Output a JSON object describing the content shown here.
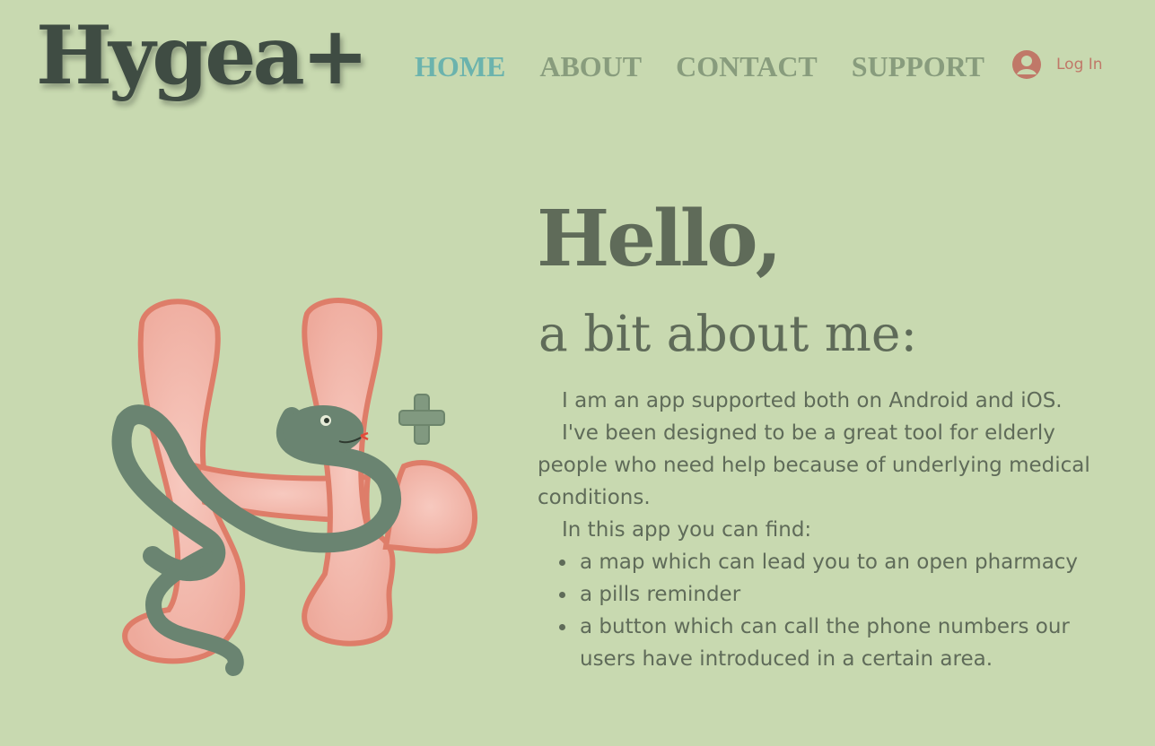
{
  "logo": {
    "text": "Hygea+"
  },
  "nav": {
    "items": [
      {
        "label": "HOME",
        "active": true
      },
      {
        "label": "ABOUT",
        "active": false
      },
      {
        "label": "CONTACT",
        "active": false
      },
      {
        "label": "SUPPORT",
        "active": false
      }
    ]
  },
  "login": {
    "label": "Log In",
    "icon": "user-avatar-icon"
  },
  "hero": {
    "title": "Hello,",
    "subtitle": "a bit about me:",
    "paragraphs": [
      "I am an app supported both on Android and iOS.",
      "I've been designed to be a great tool for elderly people who need help because of underlying medical conditions.",
      "In this app you can find:"
    ],
    "features": [
      "a map which can lead you to an open pharmacy",
      "a pills reminder",
      "a button which can call the phone numbers our users have introduced in a certain area."
    ]
  },
  "illustration": {
    "icon": "h-letter-with-snake-illustration"
  },
  "colors": {
    "background": "#c8d9b0",
    "logo": "#3f4c43",
    "nav": "#889c7d",
    "nav_active": "#6bb3ad",
    "text": "#5f6b59",
    "login": "#c07868",
    "pink": "#f3b9ad",
    "pink_border": "#de7d69",
    "snake": "#6a8471"
  }
}
